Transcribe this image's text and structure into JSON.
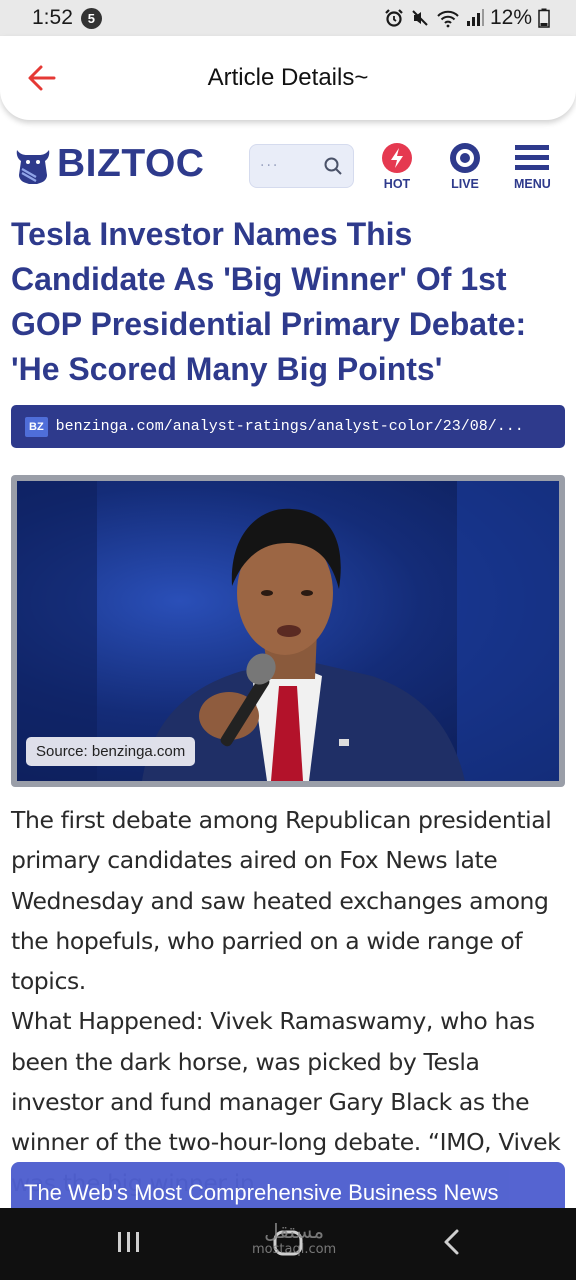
{
  "status_bar": {
    "time": "1:52",
    "notification_count": "5",
    "battery": "12%"
  },
  "app_header": {
    "title": "Article Details~"
  },
  "site": {
    "logo_text": "BIZTOC",
    "search_placeholder": "···",
    "nav": [
      {
        "label": "HOT",
        "icon": "bolt-icon"
      },
      {
        "label": "LIVE",
        "icon": "live-target-icon"
      },
      {
        "label": "MENU",
        "icon": "hamburger-menu-icon"
      }
    ],
    "brand_color": "#2e3a8c"
  },
  "article": {
    "headline": "Tesla Investor Names This Candidate As 'Big Winner' Of 1st GOP Presidential Primary Debate: 'He Scored Many Big Points'",
    "source_badge": "BZ",
    "source_url": "benzinga.com/analyst-ratings/analyst-color/23/08/...",
    "image_caption": "Source: benzinga.com",
    "paragraphs": [
      "The first debate among Republican presidential primary candidates aired on Fox News late Wednesday and saw heated exchanges among the hopefuls, who parried on a wide range of topics.",
      "What Happened: Vivek Ramaswamy, who has been the dark horse, was picked by Tesla investor and fund manager Gary Black as the winner of the two-hour-long debate. “IMO, Vivek was the big winner in"
    ]
  },
  "promo_banner": {
    "text": "The Web's Most Comprehensive Business News"
  },
  "watermark": {
    "arabic": "مستقل",
    "latin": "mostaql.com"
  }
}
